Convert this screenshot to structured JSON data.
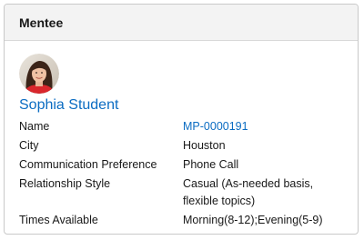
{
  "card": {
    "title": "Mentee",
    "person_name": "Sophia Student"
  },
  "fields": [
    {
      "label": "Name",
      "value": "MP-0000191",
      "is_link": true
    },
    {
      "label": "City",
      "value": "Houston"
    },
    {
      "label": "Communication Preference",
      "value": "Phone Call"
    },
    {
      "label": "Relationship Style",
      "value": "Casual (As-needed basis, flexible topics)"
    },
    {
      "label": "Times Available",
      "value": "Morning(8-12);Evening(5-9)"
    }
  ],
  "colors": {
    "link": "#0b6cc2",
    "header_bg": "#f3f3f3",
    "border": "#c9c9c9"
  }
}
